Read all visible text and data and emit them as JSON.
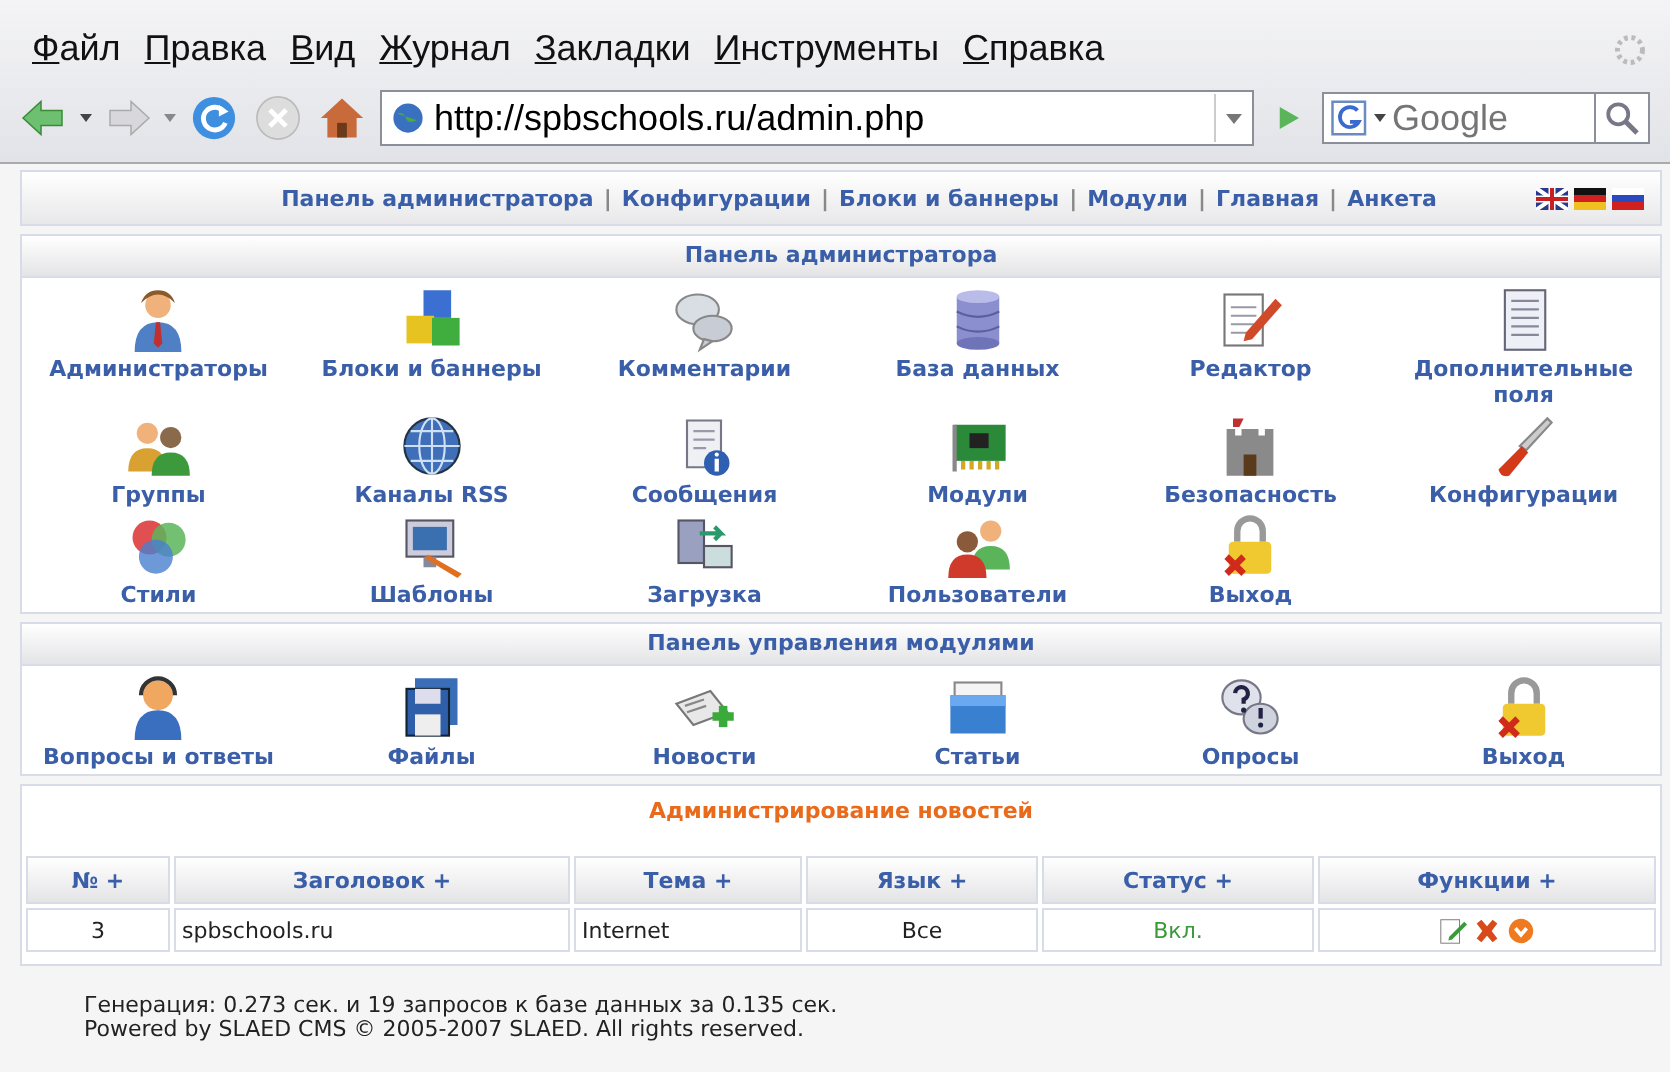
{
  "browser": {
    "menu": [
      "Файл",
      "Правка",
      "Вид",
      "Журнал",
      "Закладки",
      "Инструменты",
      "Справка"
    ],
    "url": "http://spbschools.ru/admin.php",
    "search_placeholder": "Google"
  },
  "top_nav": {
    "links": [
      "Панель администратора",
      "Конфигурации",
      "Блоки и баннеры",
      "Модули",
      "Главная",
      "Анкета"
    ],
    "separator": "|"
  },
  "admin_panel": {
    "title": "Панель администратора",
    "items": [
      {
        "label": "Администраторы"
      },
      {
        "label": "Блоки и баннеры"
      },
      {
        "label": "Комментарии"
      },
      {
        "label": "База данных"
      },
      {
        "label": "Редактор"
      },
      {
        "label": "Дополнительные поля"
      },
      {
        "label": "Группы"
      },
      {
        "label": "Каналы RSS"
      },
      {
        "label": "Сообщения"
      },
      {
        "label": "Модули"
      },
      {
        "label": "Безопасность"
      },
      {
        "label": "Конфигурации"
      },
      {
        "label": "Стили"
      },
      {
        "label": "Шаблоны"
      },
      {
        "label": "Загрузка"
      },
      {
        "label": "Пользователи"
      },
      {
        "label": "Выход"
      }
    ]
  },
  "modules_panel": {
    "title": "Панель управления модулями",
    "items": [
      {
        "label": "Вопросы и ответы"
      },
      {
        "label": "Файлы"
      },
      {
        "label": "Новости"
      },
      {
        "label": "Статьи"
      },
      {
        "label": "Опросы"
      },
      {
        "label": "Выход"
      }
    ]
  },
  "news_admin": {
    "title": "Администрирование новостей",
    "columns": [
      {
        "label": "№",
        "sort_mark": "+"
      },
      {
        "label": "Заголовок",
        "sort_mark": "+"
      },
      {
        "label": "Тема",
        "sort_mark": "+"
      },
      {
        "label": "Язык",
        "sort_mark": "+"
      },
      {
        "label": "Статус",
        "sort_mark": "+"
      },
      {
        "label": "Функции",
        "sort_mark": "+"
      }
    ],
    "rows": [
      {
        "number": "3",
        "title": "spbschools.ru",
        "topic": "Internet",
        "language": "Все",
        "status": "Вкл.",
        "enabled": true
      }
    ]
  },
  "footer": {
    "lines": [
      "Генерация: 0.273 сек. и 19 запросов к базе данных за 0.135 сек.",
      "Powered by SLAED CMS © 2005-2007 SLAED. All rights reserved."
    ]
  }
}
